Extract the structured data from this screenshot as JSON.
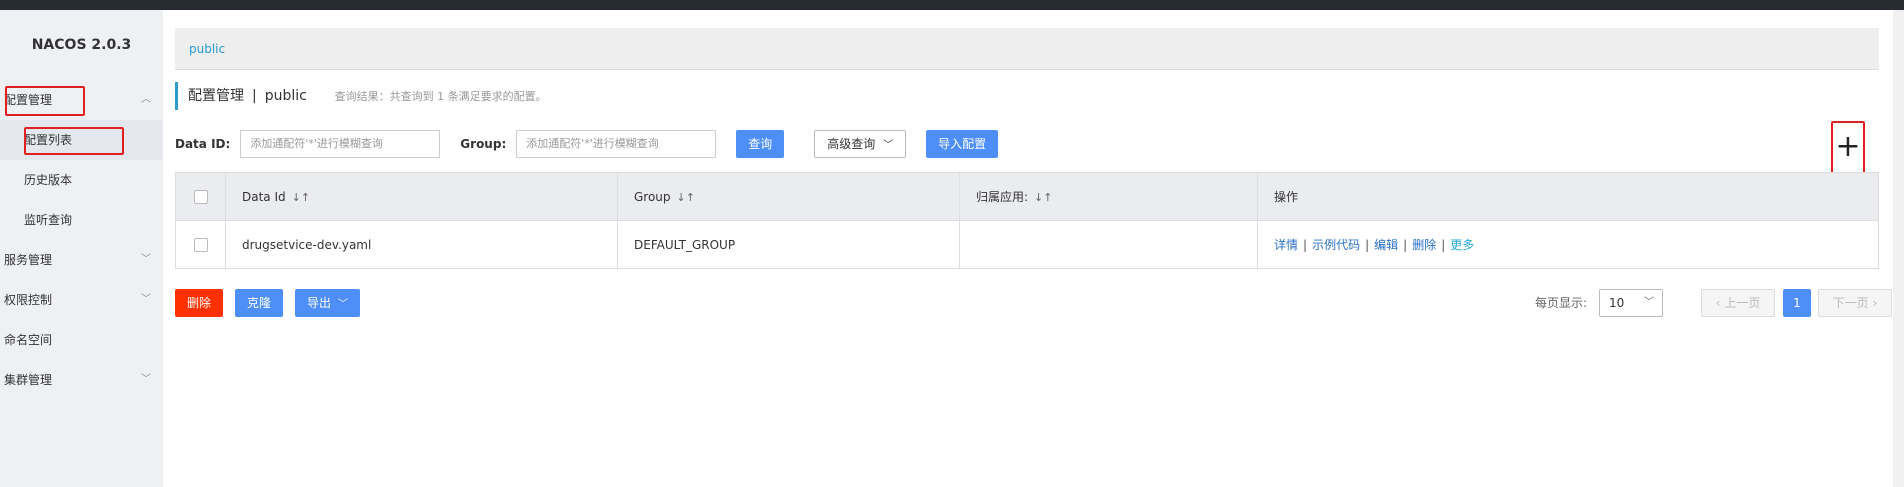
{
  "app": {
    "title": "NACOS 2.0.3"
  },
  "sidebar": {
    "items": [
      {
        "label": "配置管理",
        "expanded": true
      },
      {
        "label": "配置列表",
        "sub": true,
        "active": true
      },
      {
        "label": "历史版本",
        "sub": true
      },
      {
        "label": "监听查询",
        "sub": true
      },
      {
        "label": "服务管理"
      },
      {
        "label": "权限控制"
      },
      {
        "label": "命名空间"
      },
      {
        "label": "集群管理"
      }
    ]
  },
  "breadcrumb": {
    "namespace": "public"
  },
  "header": {
    "title": "配置管理",
    "separator": "|",
    "namespace": "public",
    "result_hint": "查询结果：共查询到 1 条满足要求的配置。"
  },
  "search": {
    "data_id_label": "Data ID:",
    "data_id_placeholder": "添加通配符'*'进行模糊查询",
    "group_label": "Group:",
    "group_placeholder": "添加通配符'*'进行模糊查询",
    "query_label": "查询",
    "advanced_label": "高级查询",
    "import_label": "导入配置"
  },
  "table": {
    "columns": [
      "Data Id",
      "Group",
      "归属应用:",
      "操作"
    ],
    "rows": [
      {
        "data_id": "drugsetvice-dev.yaml",
        "group": "DEFAULT_GROUP",
        "app": "",
        "ops": [
          "详情",
          "示例代码",
          "编辑",
          "删除",
          "更多"
        ]
      }
    ]
  },
  "actions": {
    "delete_label": "删除",
    "clone_label": "克隆",
    "export_label": "导出"
  },
  "pager": {
    "page_size_label": "每页显示:",
    "page_size": "10",
    "prev_label": "上一页",
    "current_page": "1",
    "next_label": "下一页"
  },
  "colors": {
    "accent": "#4d8ef8",
    "danger": "#ff3000",
    "link": "#2a70c9",
    "highlight_box": "#e02020"
  }
}
